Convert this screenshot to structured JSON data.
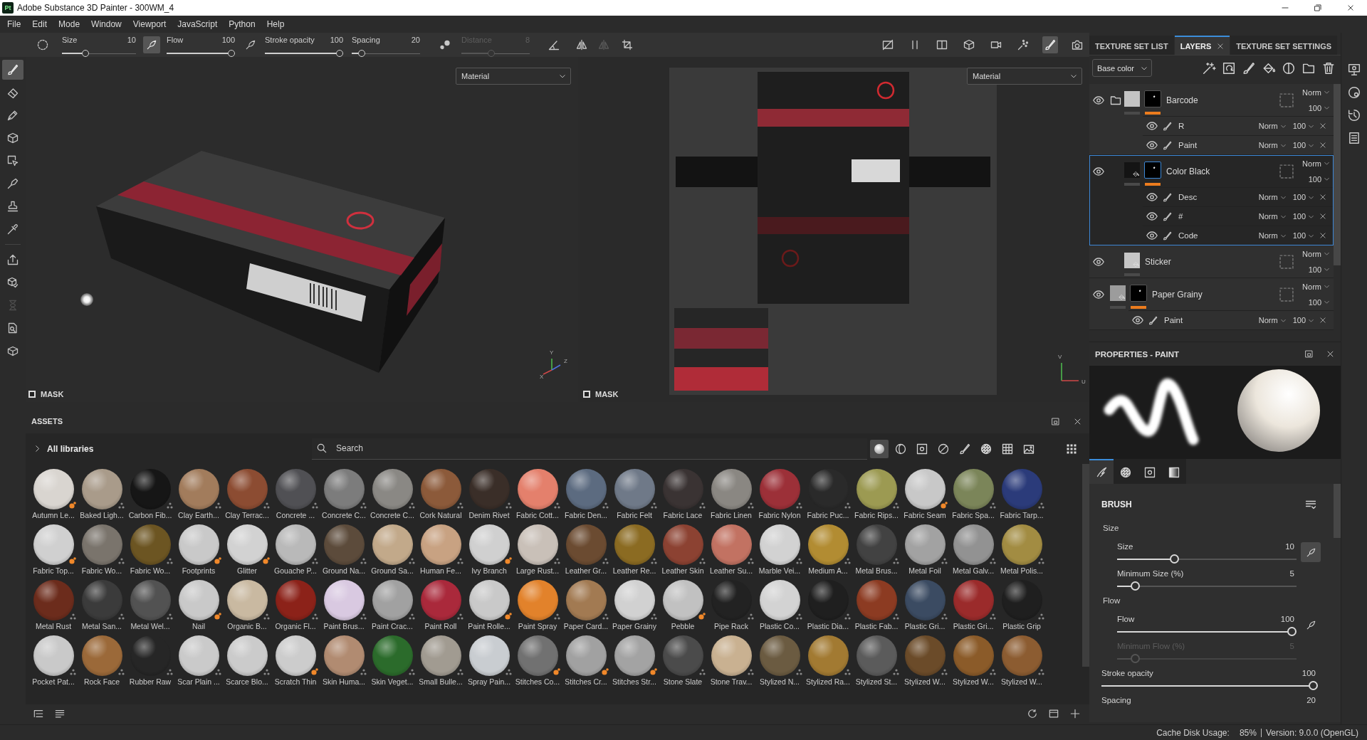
{
  "title_bar": {
    "app_icon": "Pt",
    "title": "Adobe Substance 3D Painter - 300WM_4"
  },
  "menu": [
    "File",
    "Edit",
    "Mode",
    "Window",
    "Viewport",
    "JavaScript",
    "Python",
    "Help"
  ],
  "toolbar": {
    "sliders": [
      {
        "label": "Size",
        "value": "10",
        "level": 0.3,
        "disabled": false,
        "pressure": true
      },
      {
        "label": "Flow",
        "value": "100",
        "level": 1,
        "disabled": false,
        "pressure": false
      },
      {
        "label": "Stroke opacity",
        "value": "100",
        "level": 1,
        "disabled": false
      },
      {
        "label": "Spacing",
        "value": "20",
        "level": 0.1,
        "disabled": false
      },
      {
        "label": "Distance",
        "value": "8",
        "level": 0.43,
        "disabled": true
      }
    ],
    "symmetry": [
      {
        "disabled": false
      },
      {
        "disabled": true
      },
      {
        "disabled": false
      }
    ],
    "view_tools": [
      {
        "selected": false
      },
      {
        "selected": false
      },
      {
        "selected": false
      },
      {
        "selected": false
      },
      {
        "selected": false
      },
      {
        "selected": false
      },
      {
        "selected": true
      },
      {
        "selected": false
      }
    ]
  },
  "tools": [
    {
      "selected": true,
      "disabled": false
    },
    {
      "selected": false,
      "disabled": false
    },
    {
      "selected": false,
      "disabled": false
    },
    {
      "selected": false,
      "disabled": false
    },
    {
      "selected": false,
      "disabled": false
    },
    {
      "selected": false,
      "disabled": false
    },
    {
      "selected": false,
      "disabled": false
    },
    {
      "selected": false,
      "disabled": false
    },
    {
      "selected": false,
      "disabled": false
    },
    {
      "selected": false,
      "disabled": false
    },
    {
      "selected": false,
      "disabled": true
    },
    {
      "selected": false,
      "disabled": false
    },
    {
      "selected": false,
      "disabled": false
    }
  ],
  "viewports": [
    {
      "kind": "model",
      "mode": "Material",
      "mask": {
        "label": "MASK",
        "checked": false
      },
      "axes": [
        "X",
        "Y",
        "Z"
      ]
    },
    {
      "kind": "texture",
      "mode": "Material",
      "mask": {
        "label": "MASK",
        "checked": false
      },
      "axes": [
        "V",
        "U"
      ]
    }
  ],
  "assets": {
    "title": "ASSETS",
    "library": "All libraries",
    "search": {
      "placeholder": "Search"
    },
    "filters": [
      {
        "selected": true
      },
      {
        "selected": false
      },
      {
        "selected": false
      },
      {
        "selected": false
      },
      {
        "selected": false
      },
      {
        "selected": false
      },
      {
        "selected": false
      },
      {
        "selected": false
      }
    ],
    "items": [
      {
        "name": "Autumn Le...",
        "color": "#d9d5d0",
        "kind": "smart"
      },
      {
        "name": "Baked Ligh...",
        "color": "#a99b8a",
        "kind": "material"
      },
      {
        "name": "Carbon Fib...",
        "color": "#161616",
        "kind": "material"
      },
      {
        "name": "Clay Earth...",
        "color": "#a27c5c",
        "kind": "material"
      },
      {
        "name": "Clay Terrac...",
        "color": "#8c4c32",
        "kind": "material"
      },
      {
        "name": "Concrete ...",
        "color": "#505054",
        "kind": "material"
      },
      {
        "name": "Concrete C...",
        "color": "#7c7c7c",
        "kind": "material"
      },
      {
        "name": "Concrete C...",
        "color": "#8a8884",
        "kind": "material"
      },
      {
        "name": "Cork Natural",
        "color": "#8c5a3a",
        "kind": "material"
      },
      {
        "name": "Denim Rivet",
        "color": "#3a2e28",
        "kind": "material"
      },
      {
        "name": "Fabric Cott...",
        "color": "#e4806c",
        "kind": "material"
      },
      {
        "name": "Fabric Den...",
        "color": "#5c6b80",
        "kind": "material"
      },
      {
        "name": "Fabric Felt",
        "color": "#6f7988",
        "kind": "material"
      },
      {
        "name": "Fabric Lace",
        "color": "#3a3333",
        "kind": "material"
      },
      {
        "name": "Fabric Linen",
        "color": "#8a8782",
        "kind": "material"
      },
      {
        "name": "Fabric Nylon",
        "color": "#9c3038",
        "kind": "material"
      },
      {
        "name": "Fabric Puc...",
        "color": "#2a2a2a",
        "kind": "material"
      },
      {
        "name": "Fabric Rips...",
        "color": "#9c9a52",
        "kind": "material"
      },
      {
        "name": "Fabric Seam",
        "color": "#c8c8c8",
        "kind": "smart"
      },
      {
        "name": "Fabric Spa...",
        "color": "#7b8559",
        "kind": "material"
      },
      {
        "name": "Fabric Tarp...",
        "color": "#2b3b7a",
        "kind": "material"
      },
      {
        "name": "Fabric Top...",
        "color": "#d0d0d0",
        "kind": "smart"
      },
      {
        "name": "Fabric Wo...",
        "color": "#7a746c",
        "kind": "material"
      },
      {
        "name": "Fabric Wo...",
        "color": "#6c5522",
        "kind": "material"
      },
      {
        "name": "Footprints",
        "color": "#c9c9c9",
        "kind": "smart"
      },
      {
        "name": "Glitter",
        "color": "#d2d2d2",
        "kind": "smart"
      },
      {
        "name": "Gouache P...",
        "color": "#b9b9b9",
        "kind": "material"
      },
      {
        "name": "Ground Na...",
        "color": "#5c4b3b",
        "kind": "material"
      },
      {
        "name": "Ground Sa...",
        "color": "#c2a98a",
        "kind": "material"
      },
      {
        "name": "Human Fe...",
        "color": "#c8a282",
        "kind": "material"
      },
      {
        "name": "Ivy Branch",
        "color": "#d0d0d0",
        "kind": "smart"
      },
      {
        "name": "Large Rust...",
        "color": "#c9c0b8",
        "kind": "material"
      },
      {
        "name": "Leather Gr...",
        "color": "#6b4b31",
        "kind": "material"
      },
      {
        "name": "Leather Re...",
        "color": "#8b6b22",
        "kind": "material"
      },
      {
        "name": "Leather Skin",
        "color": "#8c4232",
        "kind": "material"
      },
      {
        "name": "Leather Su...",
        "color": "#c27262",
        "kind": "material"
      },
      {
        "name": "Marble Vei...",
        "color": "#d2d2d2",
        "kind": "material"
      },
      {
        "name": "Medium A...",
        "color": "#b28c32",
        "kind": "material"
      },
      {
        "name": "Metal Brus...",
        "color": "#424242",
        "kind": "material"
      },
      {
        "name": "Metal Foil",
        "color": "#a2a2a2",
        "kind": "material"
      },
      {
        "name": "Metal Galv...",
        "color": "#929292",
        "kind": "material"
      },
      {
        "name": "Metal Polis...",
        "color": "#a28c42",
        "kind": "material"
      },
      {
        "name": "Metal Rust",
        "color": "#6c2c1c",
        "kind": "material"
      },
      {
        "name": "Metal San...",
        "color": "#3b3b3b",
        "kind": "material"
      },
      {
        "name": "Metal Wel...",
        "color": "#525252",
        "kind": "material"
      },
      {
        "name": "Nail",
        "color": "#c9c9c9",
        "kind": "smart"
      },
      {
        "name": "Organic B...",
        "color": "#c9b9a1",
        "kind": "material"
      },
      {
        "name": "Organic Fl...",
        "color": "#8c2219",
        "kind": "material"
      },
      {
        "name": "Paint Brus...",
        "color": "#d9c9e1",
        "kind": "material"
      },
      {
        "name": "Paint Crac...",
        "color": "#a1a1a1",
        "kind": "material"
      },
      {
        "name": "Paint Roll",
        "color": "#aa293b",
        "kind": "material"
      },
      {
        "name": "Paint Rolle...",
        "color": "#c9c9c9",
        "kind": "smart"
      },
      {
        "name": "Paint Spray",
        "color": "#e2822b",
        "kind": "material"
      },
      {
        "name": "Paper Card...",
        "color": "#a27a52",
        "kind": "material"
      },
      {
        "name": "Paper Grainy",
        "color": "#d1d1d1",
        "kind": "material"
      },
      {
        "name": "Pebble",
        "color": "#c1c1c1",
        "kind": "smart"
      },
      {
        "name": "Pipe Rack",
        "color": "#222222",
        "kind": "material"
      },
      {
        "name": "Plastic Co...",
        "color": "#d3d3d3",
        "kind": "material"
      },
      {
        "name": "Plastic Dia...",
        "color": "#1f1f1f",
        "kind": "material"
      },
      {
        "name": "Plastic Fab...",
        "color": "#8c3b22",
        "kind": "material"
      },
      {
        "name": "Plastic Gri...",
        "color": "#3b4b62",
        "kind": "material"
      },
      {
        "name": "Plastic Gri...",
        "color": "#9b2b2b",
        "kind": "material"
      },
      {
        "name": "Plastic Grip",
        "color": "#1f1f1f",
        "kind": "material"
      },
      {
        "name": "Pocket Pat...",
        "color": "#c9c9c9",
        "kind": "material"
      },
      {
        "name": "Rock Face",
        "color": "#9b6939",
        "kind": "material"
      },
      {
        "name": "Rubber Raw",
        "color": "#262626",
        "kind": "material"
      },
      {
        "name": "Scar Plain ...",
        "color": "#cacaca",
        "kind": "material"
      },
      {
        "name": "Scarce Blo...",
        "color": "#cbcbcb",
        "kind": "material"
      },
      {
        "name": "Scratch Thin",
        "color": "#cccccc",
        "kind": "smart"
      },
      {
        "name": "Skin Huma...",
        "color": "#b18b71",
        "kind": "material"
      },
      {
        "name": "Skin Veget...",
        "color": "#2b6b2b",
        "kind": "material"
      },
      {
        "name": "Small Bulle...",
        "color": "#a19b91",
        "kind": "material"
      },
      {
        "name": "Spray Pain...",
        "color": "#c9cdd1",
        "kind": "material"
      },
      {
        "name": "Stitches Co...",
        "color": "#717171",
        "kind": "smart"
      },
      {
        "name": "Stitches Cr...",
        "color": "#a1a1a1",
        "kind": "smart"
      },
      {
        "name": "Stitches Str...",
        "color": "#a3a3a3",
        "kind": "smart"
      },
      {
        "name": "Stone Slate",
        "color": "#4b4b4b",
        "kind": "material"
      },
      {
        "name": "Stone Trav...",
        "color": "#c9b191",
        "kind": "material"
      },
      {
        "name": "Stylized N...",
        "color": "#6b5b41",
        "kind": "material"
      },
      {
        "name": "Stylized Ra...",
        "color": "#a27a32",
        "kind": "material"
      },
      {
        "name": "Stylized St...",
        "color": "#5b5b5b",
        "kind": "material"
      },
      {
        "name": "Stylized W...",
        "color": "#6b4b29",
        "kind": "material"
      },
      {
        "name": "Stylized W...",
        "color": "#8b5b29",
        "kind": "material"
      },
      {
        "name": "Stylized W...",
        "color": "#8c5c31",
        "kind": "material"
      }
    ]
  },
  "layers_panel": {
    "tabs": [
      {
        "label": "TEXTURE SET LIST",
        "selected": false,
        "closable": false
      },
      {
        "label": "LAYERS",
        "selected": true,
        "closable": true
      },
      {
        "label": "TEXTURE SET SETTINGS",
        "selected": false,
        "closable": false
      }
    ],
    "channel": "Base color",
    "layers": [
      {
        "name": "Barcode",
        "kind": "folder",
        "visible": true,
        "selected": false,
        "color": "#c4c4c4",
        "mask": true,
        "blend": "Norm",
        "opacity": "100",
        "effects": [
          {
            "name": "R",
            "visible": true,
            "blend": "Norm",
            "opacity": "100"
          },
          {
            "name": "Paint",
            "visible": true,
            "blend": "Norm",
            "opacity": "100"
          }
        ],
        "children": [
          {
            "name": "Color Black",
            "kind": "fill",
            "visible": true,
            "selected": true,
            "color": "#141414",
            "mask": true,
            "blend": "Norm",
            "opacity": "100",
            "effects": [
              {
                "name": "Desc",
                "visible": true,
                "blend": "Norm",
                "opacity": "100"
              },
              {
                "name": "#",
                "visible": true,
                "blend": "Norm",
                "opacity": "100"
              },
              {
                "name": "Code",
                "visible": true,
                "blend": "Norm",
                "opacity": "100"
              }
            ]
          },
          {
            "name": "Sticker",
            "kind": "fill",
            "visible": true,
            "selected": false,
            "color": "#c6c6c6",
            "mask": false,
            "blend": "Norm",
            "opacity": "100"
          }
        ]
      },
      {
        "name": "Paper Grainy",
        "kind": "fill",
        "visible": true,
        "selected": false,
        "color": "#9c9c9c",
        "mask": true,
        "blend": "Norm",
        "opacity": "100",
        "effects": [
          {
            "name": "Paint",
            "visible": true,
            "blend": "Norm",
            "opacity": "100"
          }
        ]
      }
    ]
  },
  "properties": {
    "title": "PROPERTIES - PAINT",
    "tabs": [
      {
        "selected": true
      },
      {
        "selected": false
      },
      {
        "selected": false
      },
      {
        "selected": false
      }
    ],
    "section": "BRUSH",
    "groups": [
      {
        "label": "Size",
        "sliders": [
          {
            "label": "Size",
            "value": "10",
            "level": 0.31,
            "disabled": false,
            "pressure": true
          },
          {
            "label": "Minimum Size (%)",
            "value": "5",
            "level": 0.08,
            "disabled": false
          }
        ]
      },
      {
        "label": "Flow",
        "sliders": [
          {
            "label": "Flow",
            "value": "100",
            "level": 1,
            "disabled": false,
            "pressure": false
          },
          {
            "label": "Minimum Flow (%)",
            "value": "5",
            "level": 0.08,
            "disabled": true
          }
        ]
      }
    ],
    "sliders": [
      {
        "label": "Stroke opacity",
        "value": "100",
        "level": 1,
        "disabled": false
      },
      {
        "label": "Spacing",
        "value": "20",
        "disabled": false
      }
    ]
  },
  "status_bar": {
    "cache_label": "Cache Disk Usage:",
    "cache_value": "85%",
    "version": "Version: 9.0.0 (OpenGL)"
  }
}
